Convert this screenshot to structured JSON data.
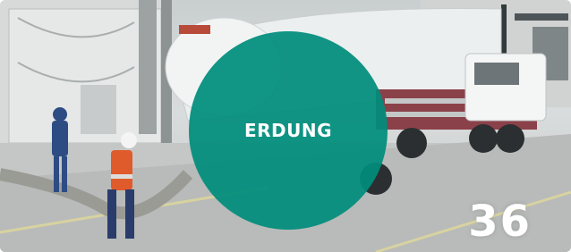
{
  "badge": {
    "label": "ERDUNG",
    "color": "#008d7c"
  },
  "page_number": "36",
  "photo": {
    "description_icon": "tanker-truck-grounding-photo"
  }
}
